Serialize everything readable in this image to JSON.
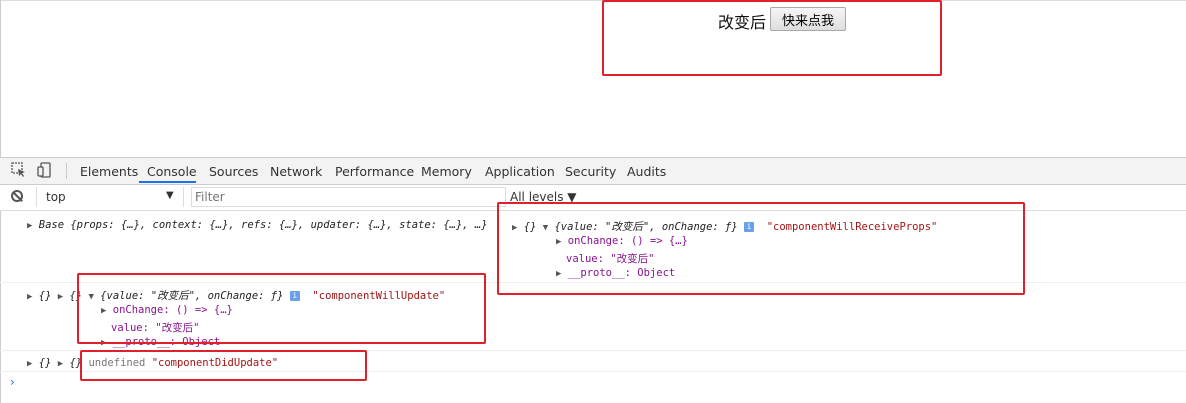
{
  "page": {
    "text": "改变后",
    "button_label": "快来点我"
  },
  "devtools": {
    "tabs": [
      "Elements",
      "Console",
      "Sources",
      "Network",
      "Performance",
      "Memory",
      "Application",
      "Security",
      "Audits"
    ],
    "active_tab": "Console",
    "context_selector": "top",
    "filter_placeholder": "Filter",
    "levels_label": "All levels ▼"
  },
  "console": {
    "row1": {
      "base_line": "Base {props: {…}, context: {…}, refs: {…}, updater: {…}, state: {…}, …}",
      "obj_marker": "{}",
      "value_summary": "{value: \"改变后\", onChange: ƒ}",
      "label": "\"componentWillReceiveProps\"",
      "onchange_line": "onChange: () => {…}",
      "value_line": "value: \"改变后\"",
      "proto_line": "__proto__: Object"
    },
    "row2": {
      "obj_marker1": "{}",
      "obj_marker2": "{}",
      "value_summary": "{value: \"改变后\", onChange: ƒ}",
      "label": "\"componentWillUpdate\"",
      "onchange_line": "onChange: () => {…}",
      "value_line": "value: \"改变后\"",
      "proto_line": "__proto__: Object"
    },
    "row3": {
      "obj_marker1": "{}",
      "obj_marker2": "{}",
      "undefined_text": "undefined",
      "label": "\"componentDidUpdate\""
    },
    "prompt": "›"
  },
  "colors": {
    "annotation_box": "#e0202a",
    "active_tab_underline": "#1a73e8"
  }
}
